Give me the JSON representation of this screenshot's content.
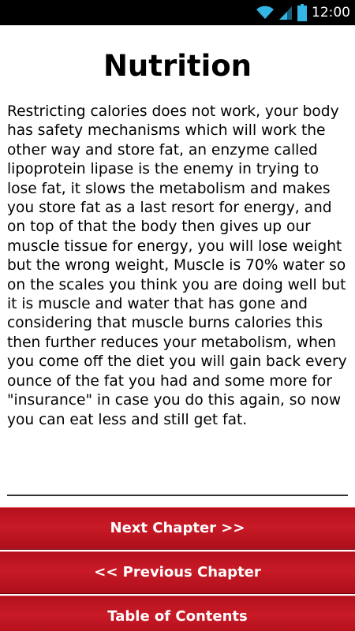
{
  "status_bar": {
    "time": "12:00",
    "icons": [
      "wifi-icon",
      "signal-icon",
      "battery-icon"
    ]
  },
  "page": {
    "title": "Nutrition",
    "body": "Restricting calories does not work, your body has safety mechanisms which will work the other way and store fat, an enzyme called lipoprotein lipase is the enemy in trying to lose fat, it slows the metabolism and makes you store fat as a last resort for energy, and on top of that the body then gives up our muscle tissue for energy, you will lose weight but the wrong weight, Muscle is 70% water so on the scales you think you are doing well but it is muscle and water that has gone and considering that muscle burns calories this then further reduces your metabolism, when you come off the diet you will gain back every ounce of the fat you had and some more for \"insurance\" in case you do this again, so now you can eat less and still get fat."
  },
  "buttons": {
    "next_label": "Next Chapter >>",
    "prev_label": "<< Previous Chapter",
    "toc_label": "Table of Contents"
  },
  "colors": {
    "button_red": "#c81a26",
    "status_bar": "#000000",
    "status_icon_blue": "#33b5e5"
  }
}
